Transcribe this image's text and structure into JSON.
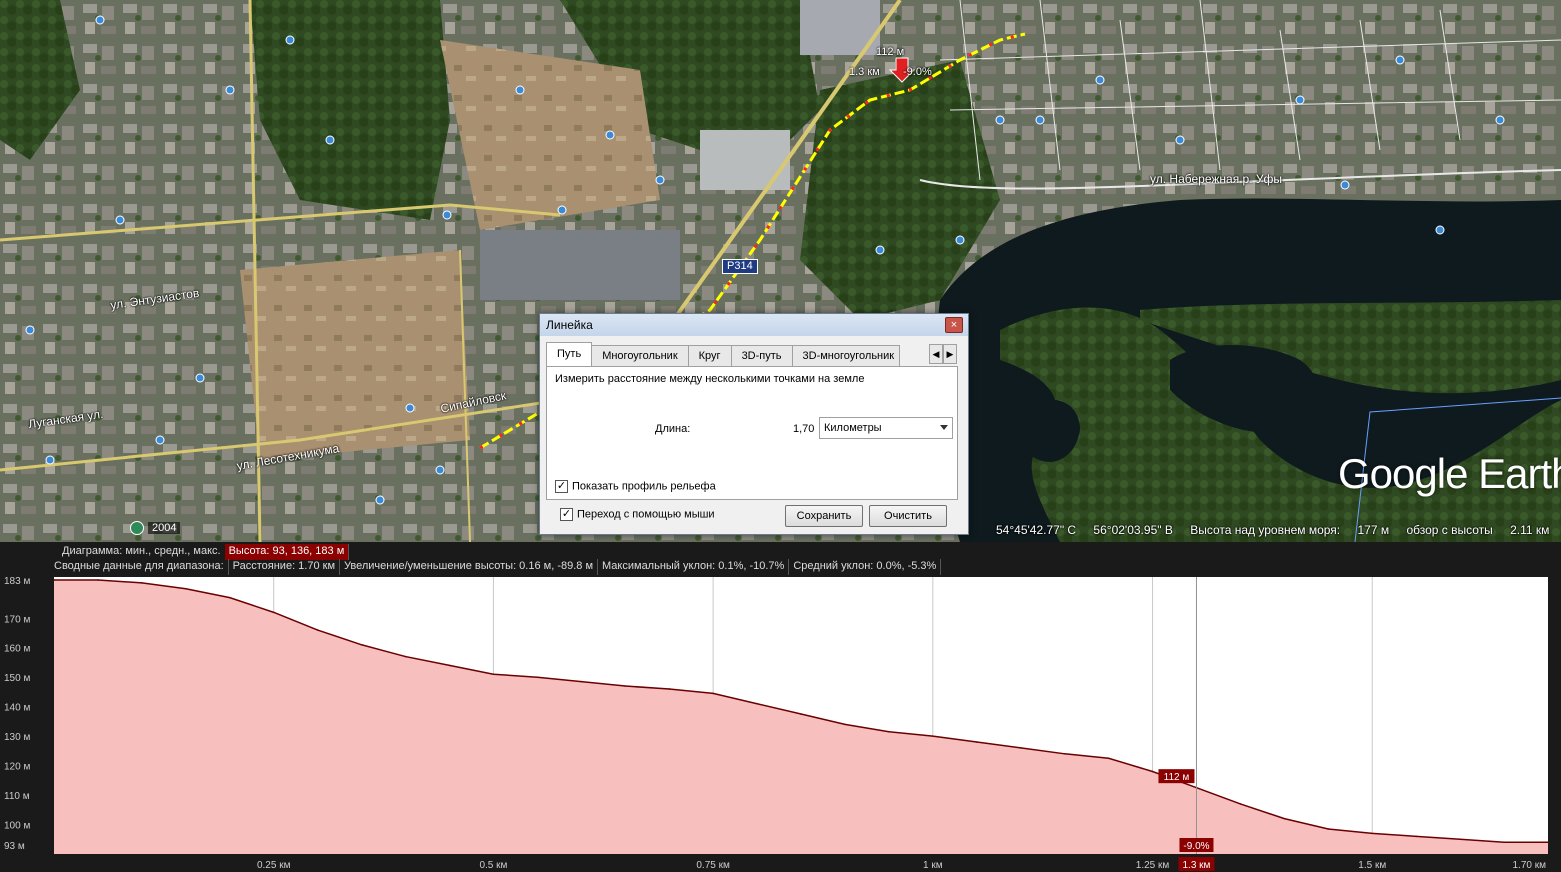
{
  "map": {
    "labels": {
      "street_naberezhnaya": "ул. Набережная р. Уфы",
      "street_lesotekhnikuma": "ул. Лесотехникума",
      "street_sipaylovskaya": "Сипайловск",
      "street_enthuziastov": "ул. Энтузиастов",
      "street_ruganskaya": "Луганская ул.",
      "route_badge": "Р314"
    },
    "callout": {
      "elevation": "112 м",
      "distance": "1.3 км",
      "slope": "-9.0%"
    },
    "logo": "Google Earth",
    "year": "2004",
    "status": {
      "lat": "54°45'42.77\" С",
      "lon": "56°02'03.95\" В",
      "elev_label": "Высота над уровнем моря:",
      "elev_value": "177 м",
      "eye_label": "обзор с высоты",
      "eye_value": "2.11 км"
    }
  },
  "dialog": {
    "title": "Линейка",
    "close": "×",
    "tabs": [
      "Путь",
      "Многоугольник",
      "Круг",
      "3D-путь",
      "3D-многоугольник"
    ],
    "arrow_left": "◀",
    "arrow_right": "▶",
    "description": "Измерить расстояние между несколькими точками на земле",
    "length_label": "Длина:",
    "length_value": "1,70",
    "unit": "Километры",
    "show_profile_label": "Показать профиль рельефа",
    "show_profile_checked": true,
    "mouse_nav_label": "Переход с помощью мыши",
    "mouse_nav_checked": true,
    "save_label": "Сохранить",
    "clear_label": "Очистить",
    "check_mark": "✓"
  },
  "profile": {
    "summary_top": {
      "label": "Диаграмма: мин., средн., макс.",
      "value": "Высота: 93, 136, 183 м"
    },
    "summary_bottom": {
      "label": "Сводные данные для диапазона:",
      "distance": "Расстояние: 1.70 км",
      "gain_loss": "Увеличение/уменьшение высоты: 0.16 м, -89.8 м",
      "max_slope": "Максимальный уклон: 0.1%, -10.7%",
      "avg_slope": "Средний уклон: 0.0%, -5.3%"
    },
    "cursor": {
      "distance_label": "1.3 км",
      "elevation_label": "112 м",
      "slope_label": "-9.0%",
      "distance_km": 1.3,
      "elevation_m": 112
    },
    "colors": {
      "fill": "#f8bfbf",
      "line": "#6b0000",
      "highlight": "#8b0000"
    }
  },
  "chart_data": {
    "type": "area",
    "x_unit": "км",
    "y_unit": "м",
    "xlim": [
      0,
      1.7
    ],
    "ylim": [
      90,
      184
    ],
    "y_ticks": [
      {
        "value": 183,
        "label": "183 м"
      },
      {
        "value": 170,
        "label": "170 м"
      },
      {
        "value": 160,
        "label": "160 м"
      },
      {
        "value": 150,
        "label": "150 м"
      },
      {
        "value": 140,
        "label": "140 м"
      },
      {
        "value": 130,
        "label": "130 м"
      },
      {
        "value": 120,
        "label": "120 м"
      },
      {
        "value": 110,
        "label": "110 м"
      },
      {
        "value": 100,
        "label": "100 м"
      },
      {
        "value": 93,
        "label": "93 м"
      }
    ],
    "x_ticks": [
      {
        "value": 0.25,
        "label": "0.25 км"
      },
      {
        "value": 0.5,
        "label": "0.5 км"
      },
      {
        "value": 0.75,
        "label": "0.75 км"
      },
      {
        "value": 1.0,
        "label": "1 км"
      },
      {
        "value": 1.25,
        "label": "1.25 км"
      },
      {
        "value": 1.5,
        "label": "1.5 км"
      },
      {
        "value": 1.7,
        "label": "1.70 км"
      }
    ],
    "x": [
      0,
      0.05,
      0.1,
      0.15,
      0.2,
      0.25,
      0.3,
      0.35,
      0.4,
      0.45,
      0.5,
      0.55,
      0.6,
      0.65,
      0.7,
      0.75,
      0.8,
      0.85,
      0.9,
      0.95,
      1.0,
      1.05,
      1.1,
      1.15,
      1.2,
      1.25,
      1.3,
      1.35,
      1.4,
      1.45,
      1.5,
      1.55,
      1.6,
      1.65,
      1.7
    ],
    "y": [
      183,
      183,
      182,
      180,
      177,
      172,
      166,
      161,
      157,
      154,
      151,
      150,
      148.5,
      147,
      146,
      144.5,
      141,
      137.5,
      134,
      131.5,
      130,
      128,
      126,
      124,
      122.5,
      118,
      112.5,
      107,
      102,
      98.5,
      97,
      96,
      95,
      94,
      94
    ]
  }
}
